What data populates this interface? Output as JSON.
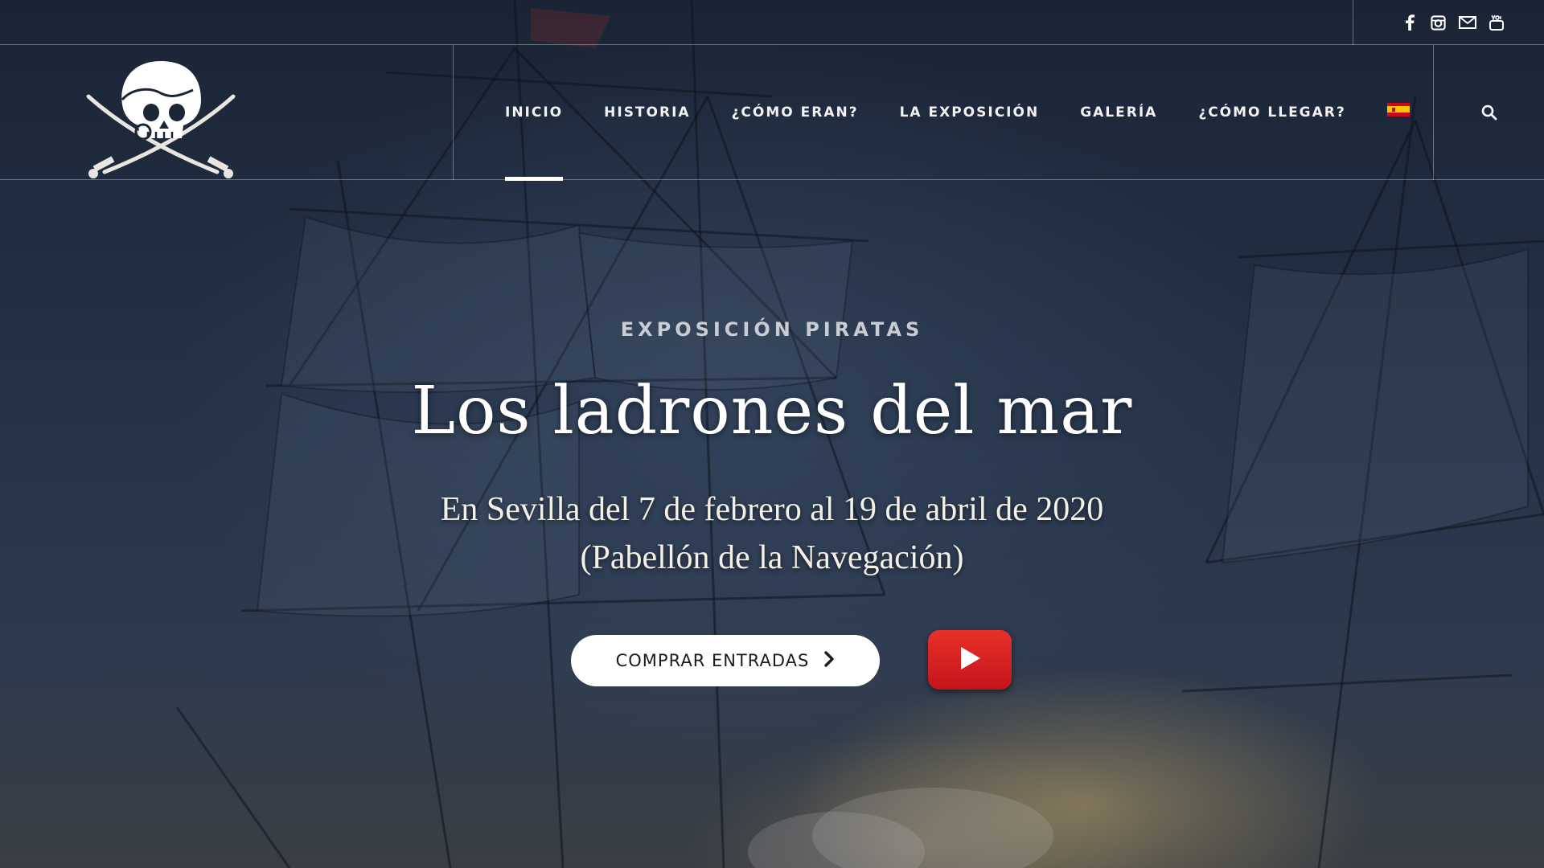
{
  "social": {
    "items": [
      {
        "icon": "facebook-icon"
      },
      {
        "icon": "instagram-icon"
      },
      {
        "icon": "mail-icon"
      },
      {
        "icon": "youtube-icon"
      }
    ]
  },
  "nav": {
    "items": [
      {
        "label": "INICIO",
        "active": true
      },
      {
        "label": "HISTORIA",
        "active": false
      },
      {
        "label": "¿CÓMO ERAN?",
        "active": false
      },
      {
        "label": "LA EXPOSICIÓN",
        "active": false
      },
      {
        "label": "GALERÍA",
        "active": false
      },
      {
        "label": "¿CÓMO LLEGAR?",
        "active": false
      }
    ],
    "language_flag": "spain-flag-icon",
    "search_icon": "search-icon"
  },
  "hero": {
    "eyebrow": "EXPOSICIÓN PIRATAS",
    "title": "Los ladrones del mar",
    "subtitle_line1": "En Sevilla del 7 de febrero al 19 de abril de 2020",
    "subtitle_line2": "(Pabellón de la Navegación)",
    "buy_label": "COMPRAR ENTRADAS",
    "buy_icon": "chevron-right-icon",
    "video_icon": "youtube-play-icon"
  },
  "colors": {
    "background": "#1b2536",
    "youtube_red": "#d8201f",
    "button_bg": "#ffffff"
  }
}
